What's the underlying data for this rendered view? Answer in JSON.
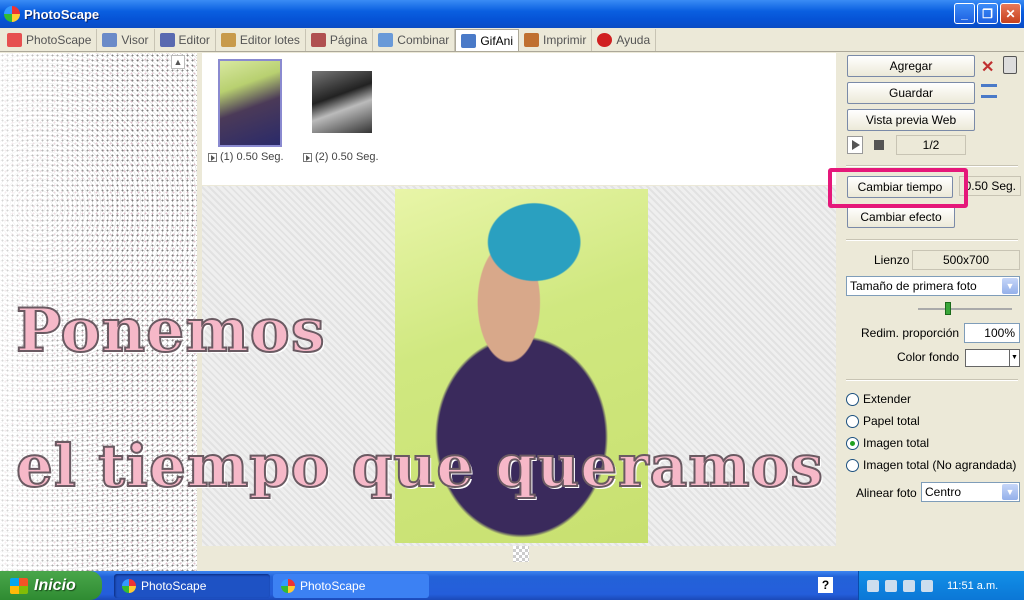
{
  "window": {
    "title": "PhotoScape"
  },
  "tabs": [
    {
      "label": "PhotoScape",
      "icon": "photoscape-icon",
      "color": "#e65050"
    },
    {
      "label": "Visor",
      "icon": "viewer-icon",
      "color": "#6a8ac8"
    },
    {
      "label": "Editor",
      "icon": "editor-icon",
      "color": "#5a6ab0"
    },
    {
      "label": "Editor lotes",
      "icon": "batch-editor-icon",
      "color": "#c89a4a"
    },
    {
      "label": "Página",
      "icon": "page-icon",
      "color": "#b05050"
    },
    {
      "label": "Combinar",
      "icon": "combine-icon",
      "color": "#6a9ad8"
    },
    {
      "label": "GifAni",
      "icon": "gifani-icon",
      "color": "#4a7ac8"
    },
    {
      "label": "Imprimir",
      "icon": "print-icon",
      "color": "#c07030"
    },
    {
      "label": "Ayuda",
      "icon": "help-icon",
      "color": "#d02020"
    }
  ],
  "thumbnails": [
    {
      "caption": "(1) 0.50 Seg."
    },
    {
      "caption": "(2) 0.50 Seg."
    }
  ],
  "overlay": {
    "line1": "Ponemos",
    "line2": "el tiempo que queramos"
  },
  "right": {
    "add": "Agregar",
    "save": "Guardar",
    "web_preview": "Vista previa Web",
    "frame_counter": "1/2",
    "change_time": "Cambiar tiempo",
    "time_value": "0.50 Seg.",
    "change_effect": "Cambiar efecto",
    "canvas_label": "Lienzo",
    "canvas_size": "500x700",
    "size_mode": "Tamaño de primera foto",
    "resize_label": "Redim. proporción",
    "resize_value": "100%",
    "bg_label": "Color fondo",
    "radios": [
      {
        "label": "Extender",
        "checked": false
      },
      {
        "label": "Papel total",
        "checked": false
      },
      {
        "label": "Imagen total",
        "checked": true
      },
      {
        "label": "Imagen total (No agrandada)",
        "checked": false
      }
    ],
    "align_label": "Alinear foto",
    "align_value": "Centro"
  },
  "taskbar": {
    "start": "Inicio",
    "tasks": [
      "PhotoScape",
      "PhotoScape"
    ],
    "time": "11:51 a.m."
  },
  "colors": {
    "highlight": "#e5187a",
    "title_bar": "#0a5fe0"
  }
}
